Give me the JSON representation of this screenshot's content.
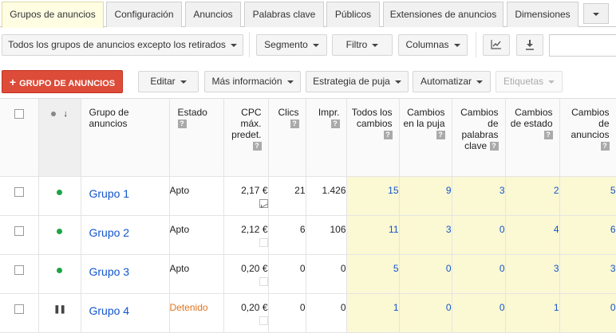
{
  "tabs": [
    "Grupos de anuncios",
    "Configuración",
    "Anuncios",
    "Palabras clave",
    "Públicos",
    "Extensiones de anuncios",
    "Dimensiones"
  ],
  "toolbar": {
    "filter_scope": "Todos los grupos de anuncios excepto los retirados",
    "segment": "Segmento",
    "filter": "Filtro",
    "columns": "Columnas"
  },
  "actions": {
    "add_group": "GRUPO DE ANUNCIOS",
    "edit": "Editar",
    "more_info": "Más información",
    "bid_strategy": "Estrategia de puja",
    "automate": "Automatizar",
    "labels": "Etiquetas"
  },
  "table": {
    "headers": {
      "group": "Grupo de anuncios",
      "status": "Estado",
      "cpc": "CPC máx. predet.",
      "clicks": "Clics",
      "impr": "Impr.",
      "all_changes": "Todos los cambios",
      "bid_changes": "Cambios en la puja",
      "kw_changes": "Cambios de palabras clave",
      "status_changes": "Cambios de estado",
      "ad_changes": "Cambios de anuncios"
    },
    "rows": [
      {
        "name": "Grupo 1",
        "status": "Apto",
        "cpc": "2,17 €",
        "clicks": "21",
        "impr": "1.426",
        "all": "15",
        "bid": "9",
        "kw": "3",
        "state": "2",
        "ads": "5"
      },
      {
        "name": "Grupo 2",
        "status": "Apto",
        "cpc": "2,12 €",
        "clicks": "6",
        "impr": "106",
        "all": "11",
        "bid": "3",
        "kw": "0",
        "state": "4",
        "ads": "6"
      },
      {
        "name": "Grupo 3",
        "status": "Apto",
        "cpc": "0,20 €",
        "clicks": "0",
        "impr": "0",
        "all": "5",
        "bid": "0",
        "kw": "0",
        "state": "3",
        "ads": "3"
      },
      {
        "name": "Grupo 4",
        "status": "Detenido",
        "cpc": "0,20 €",
        "clicks": "0",
        "impr": "0",
        "all": "1",
        "bid": "0",
        "kw": "0",
        "state": "1",
        "ads": "0"
      }
    ]
  }
}
